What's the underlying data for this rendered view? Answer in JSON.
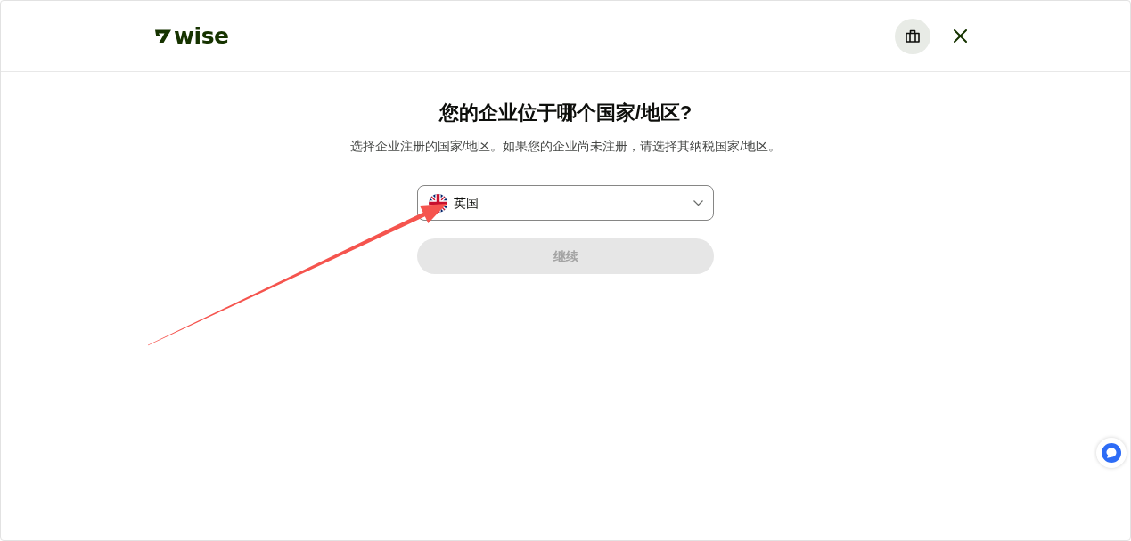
{
  "header": {
    "logo_text": "wise"
  },
  "form": {
    "title": "您的企业位于哪个国家/地区?",
    "subtitle": "选择企业注册的国家/地区。如果您的企业尚未注册，请选择其纳税国家/地区。",
    "country_select": {
      "value": "英国"
    },
    "continue_button": {
      "label": "继续",
      "disabled": true
    }
  }
}
